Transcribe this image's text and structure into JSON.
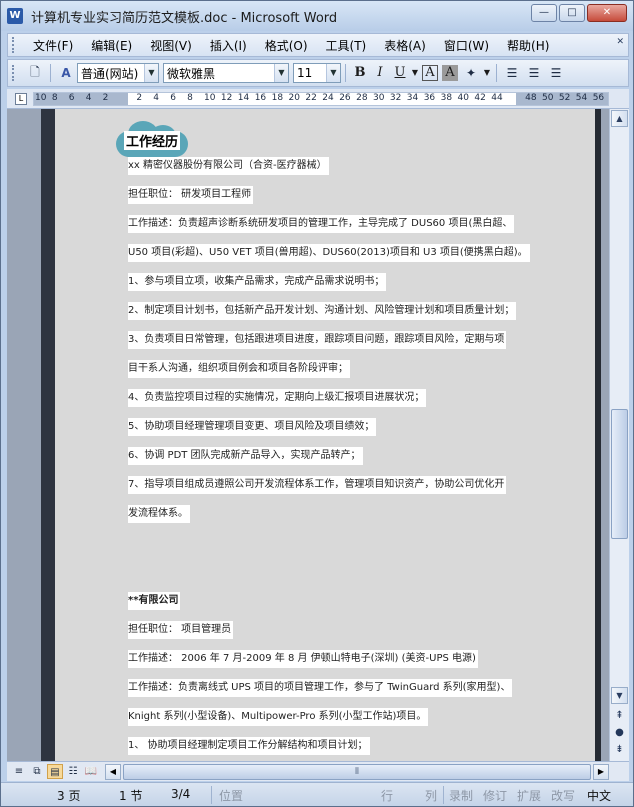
{
  "window": {
    "title": "计算机专业实习简历范文模板.doc - Microsoft Word",
    "app_icon": "W",
    "controls": {
      "minimize": "—",
      "maximize": "□",
      "close": "✕"
    }
  },
  "menu": {
    "items": [
      "文件(F)",
      "编辑(E)",
      "视图(V)",
      "插入(I)",
      "格式(O)",
      "工具(T)",
      "表格(A)",
      "窗口(W)",
      "帮助(H)"
    ]
  },
  "toolbar": {
    "style_value": "普通(网站)",
    "font_value": "微软雅黑",
    "size_value": "11",
    "bold": "B",
    "italic": "I",
    "underline": "U",
    "char_border": "A",
    "char_shade": "A",
    "styles_icon": "A"
  },
  "ruler": {
    "tab_marker": "L",
    "numbers": [
      "10",
      "8",
      "6",
      "4",
      "2",
      "",
      "2",
      "4",
      "6",
      "8",
      "10",
      "12",
      "14",
      "16",
      "18",
      "20",
      "22",
      "24",
      "26",
      "28",
      "30",
      "32",
      "34",
      "36",
      "38",
      "40",
      "42",
      "44",
      "",
      "48",
      "50",
      "52",
      "54",
      "56"
    ]
  },
  "document": {
    "section_title": "工作经历",
    "lines": [
      "xx 精密仪器股份有限公司（合资-医疗器械）",
      "担任职位： 研发项目工程师",
      "工作描述：负责超声诊断系统研发项目的管理工作，主导完成了 DUS60 项目(黑白超、",
      "U50 项目(彩超)、U50 VET 项目(兽用超)、DUS60(2013)项目和 U3 项目(便携黑白超)。",
      "1、参与项目立项，收集产品需求，完成产品需求说明书；",
      "2、制定项目计划书，包括新产品开发计划、沟通计划、风险管理计划和项目质量计划；",
      "3、负责项目日常管理，包括跟进项目进度，跟踪项目问题，跟踪项目风险，定期与项",
      "目干系人沟通，组织项目例会和项目各阶段评审；",
      "4、负责监控项目过程的实施情况，定期向上级汇报项目进展状况；",
      "5、协助项目经理管理项目变更、项目风险及项目绩效；",
      "6、协调 PDT 团队完成新产品导入，实现产品转产；",
      "7、指导项目组成员遵照公司开发流程体系工作，管理项目知识资产，协助公司优化开",
      "发流程体系。",
      "",
      "",
      "**有限公司",
      "担任职位： 项目管理员",
      "工作描述： 2006 年 7 月-2009 年 8 月 伊顿山特电子(深圳) (美资-UPS 电源)",
      "工作描述：负责离线式 UPS 项目的项目管理工作，参与了 TwinGuard 系列(家用型)、",
      "Knight 系列(小型设备)、Multipower-Pro 系列(小型工作站)项目。",
      "1、 协助项目经理制定项目工作分解结构和项目计划；"
    ]
  },
  "status": {
    "page": "3 页",
    "section": "1 节",
    "page_of": "3/4",
    "position": "位置",
    "line": "行",
    "column": "列",
    "record": "录制",
    "revise": "修订",
    "extend": "扩展",
    "overtype": "改写",
    "language": "中文"
  },
  "colors": {
    "badge_cloud": "#5aa6b8",
    "page_background": "#d9d9d9"
  }
}
